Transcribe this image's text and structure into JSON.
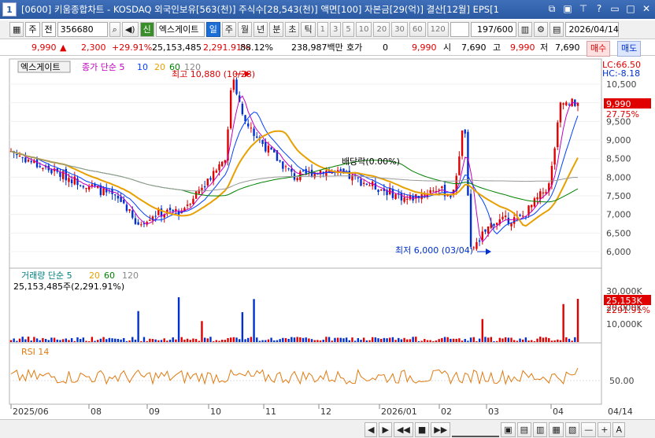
{
  "window": {
    "number": "1",
    "title": "[0600] 키움종합차트 - KOSDAQ 외국인보유[563(천)] 주식수[28,543(천)] 액면[100] 자본금[29(억)] 결산[12월] EPS[1"
  },
  "toolbar": {
    "period": "주",
    "compare": "전",
    "code": "356680",
    "badge_new": "신",
    "name": "엑스게이트",
    "units": [
      "일",
      "주",
      "월",
      "년",
      "분",
      "초",
      "틱"
    ],
    "selected_unit": "일",
    "minutes": [
      "1",
      "3",
      "5",
      "10",
      "20",
      "30",
      "60",
      "120"
    ],
    "count": "197/600",
    "date": "2026/04/14"
  },
  "quote": {
    "price": "9,990",
    "arrow": "▲",
    "change": "2,300",
    "pct": "+29.91%",
    "volume": "25,153,485",
    "vol_ratio": "2,291.91%",
    "turnover": "88.12%",
    "amount": "238,987백만",
    "hoga_label": "호가",
    "hoga": "0",
    "hoga_price": "9,990",
    "open_label": "시",
    "open": "7,690",
    "high_label": "고",
    "high": "9,990",
    "low_label": "저",
    "low": "7,690",
    "buy_label": "매수",
    "sell_label": "매도"
  },
  "legend": {
    "name": "엑스게이트",
    "price_ma": "종가 단순 5",
    "p10": "10",
    "p20": "20",
    "p60": "60",
    "p120": "120",
    "vol": "거래량 단순 5",
    "v20": "20",
    "v60": "60",
    "v120": "120",
    "vol_value": "25,153,485주(2,291.91%)",
    "rsi": "RSI 14"
  },
  "annotations": {
    "high": "최고 10,880 (10/28)",
    "low": "최저 6,000 (03/04)",
    "dividend": "배당락(0.00%)",
    "lc": "LC:66.50",
    "hc": "HC:-8.18",
    "last_price": "9,990",
    "last_pct": "27.75%",
    "last_vol": "25,153K",
    "last_vol_pct": "2291.91%"
  },
  "chart_data": {
    "type": "candlestick",
    "price_ticks": [
      "10,500",
      "10,000",
      "9,500",
      "9,000",
      "8,500",
      "8,000",
      "7,500",
      "7,000",
      "6,500",
      "6,000"
    ],
    "volume_ticks": [
      "30,000K",
      "20,000K",
      "10,000K"
    ],
    "rsi_ticks": [
      "50.00"
    ],
    "x_labels": [
      "2025/06",
      "08",
      "09",
      "10",
      "11",
      "12",
      "2026/01",
      "02",
      "03",
      "04",
      "04/14"
    ],
    "close_path": [
      [
        0,
        8700
      ],
      [
        0.05,
        8300
      ],
      [
        0.1,
        8000
      ],
      [
        0.15,
        7700
      ],
      [
        0.2,
        7300
      ],
      [
        0.22,
        6700
      ],
      [
        0.25,
        7000
      ],
      [
        0.3,
        7100
      ],
      [
        0.35,
        8000
      ],
      [
        0.38,
        8600
      ],
      [
        0.39,
        10880
      ],
      [
        0.41,
        9500
      ],
      [
        0.45,
        8800
      ],
      [
        0.5,
        8000
      ],
      [
        0.55,
        8200
      ],
      [
        0.6,
        8000
      ],
      [
        0.65,
        7700
      ],
      [
        0.7,
        7400
      ],
      [
        0.75,
        7700
      ],
      [
        0.78,
        7500
      ],
      [
        0.8,
        9600
      ],
      [
        0.81,
        6000
      ],
      [
        0.85,
        6800
      ],
      [
        0.9,
        6900
      ],
      [
        0.95,
        7800
      ],
      [
        0.97,
        9990
      ]
    ],
    "last": {
      "price": 9990,
      "volume": 25153485,
      "rsi": 66.5
    }
  },
  "statusbar": {
    "controls": [
      "◀",
      "▶",
      "◀◀",
      "■",
      "▶▶",
      "—",
      "+",
      "A"
    ]
  }
}
